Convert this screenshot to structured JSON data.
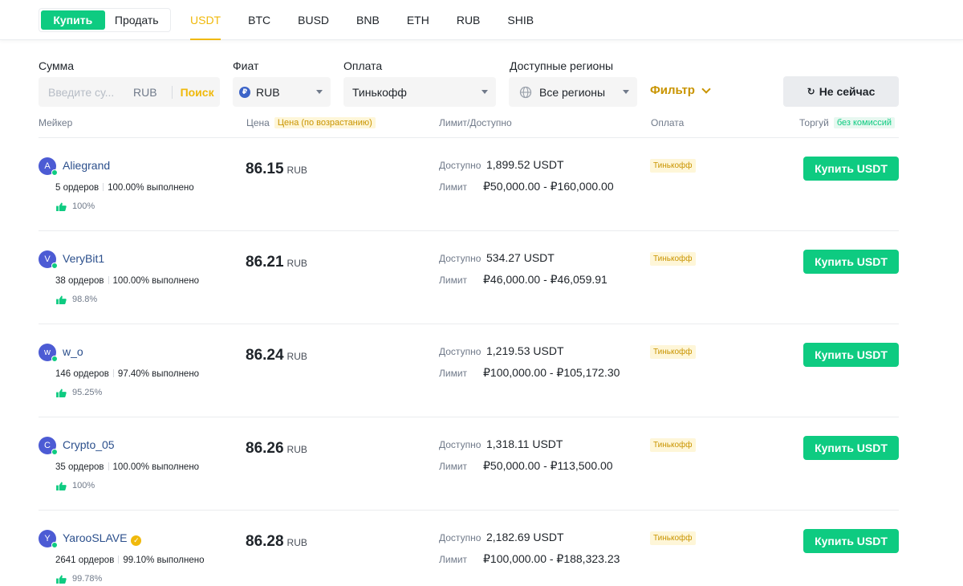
{
  "topbar": {
    "side_buy": "Купить",
    "side_sell": "Продать",
    "coins": [
      "USDT",
      "BTC",
      "BUSD",
      "BNB",
      "ETH",
      "RUB",
      "SHIB"
    ],
    "active_coin": "USDT"
  },
  "filters": {
    "amount_label": "Сумма",
    "amount_placeholder": "Введите су...",
    "amount_currency": "RUB",
    "search_label": "Поиск",
    "fiat_label": "Фиат",
    "fiat_value": "RUB",
    "fiat_icon": "₽",
    "payment_label": "Оплата",
    "payment_value": "Тинькофф",
    "regions_label": "Доступные регионы",
    "regions_value": "Все регионы",
    "filter_button": "Фильтр",
    "not_now_button": "Не сейчас"
  },
  "columns": {
    "maker": "Мейкер",
    "price": "Цена",
    "price_sort_tag": "Цена (по возрастанию)",
    "limit": "Лимит/Доступно",
    "payment": "Оплата",
    "trade": "Торгуй",
    "trade_tag": "без комиссий"
  },
  "offers": [
    {
      "initial": "A",
      "name": "Aliegrand",
      "verified": false,
      "orders": "5 ордеров",
      "completion": "100.00% выполнено",
      "rating": "100%",
      "price": "86.15",
      "price_unit": "RUB",
      "available_label": "Доступно",
      "available": "1,899.52 USDT",
      "limit_label": "Лимит",
      "limit": "₽50,000.00 - ₽160,000.00",
      "payment": "Тинькофф",
      "button": "Купить USDT"
    },
    {
      "initial": "V",
      "name": "VeryBit1",
      "verified": false,
      "orders": "38 ордеров",
      "completion": "100.00% выполнено",
      "rating": "98.8%",
      "price": "86.21",
      "price_unit": "RUB",
      "available_label": "Доступно",
      "available": "534.27 USDT",
      "limit_label": "Лимит",
      "limit": "₽46,000.00 - ₽46,059.91",
      "payment": "Тинькофф",
      "button": "Купить USDT"
    },
    {
      "initial": "w",
      "name": "w_o",
      "verified": false,
      "orders": "146 ордеров",
      "completion": "97.40% выполнено",
      "rating": "95.25%",
      "price": "86.24",
      "price_unit": "RUB",
      "available_label": "Доступно",
      "available": "1,219.53 USDT",
      "limit_label": "Лимит",
      "limit": "₽100,000.00 - ₽105,172.30",
      "payment": "Тинькофф",
      "button": "Купить USDT"
    },
    {
      "initial": "C",
      "name": "Crypto_05",
      "verified": false,
      "orders": "35 ордеров",
      "completion": "100.00% выполнено",
      "rating": "100%",
      "price": "86.26",
      "price_unit": "RUB",
      "available_label": "Доступно",
      "available": "1,318.11 USDT",
      "limit_label": "Лимит",
      "limit": "₽50,000.00 - ₽113,500.00",
      "payment": "Тинькофф",
      "button": "Купить USDT"
    },
    {
      "initial": "Y",
      "name": "YarooSLAVE",
      "verified": true,
      "orders": "2641 ордеров",
      "completion": "99.10% выполнено",
      "rating": "99.78%",
      "price": "86.28",
      "price_unit": "RUB",
      "available_label": "Доступно",
      "available": "2,182.69 USDT",
      "limit_label": "Лимит",
      "limit": "₽100,000.00 - ₽188,323.23",
      "payment": "Тинькофф",
      "button": "Купить USDT"
    }
  ],
  "colors": {
    "buy_green": "#0ecb81",
    "accent_yellow": "#f0b90b",
    "link_blue": "#2b4f8c"
  }
}
